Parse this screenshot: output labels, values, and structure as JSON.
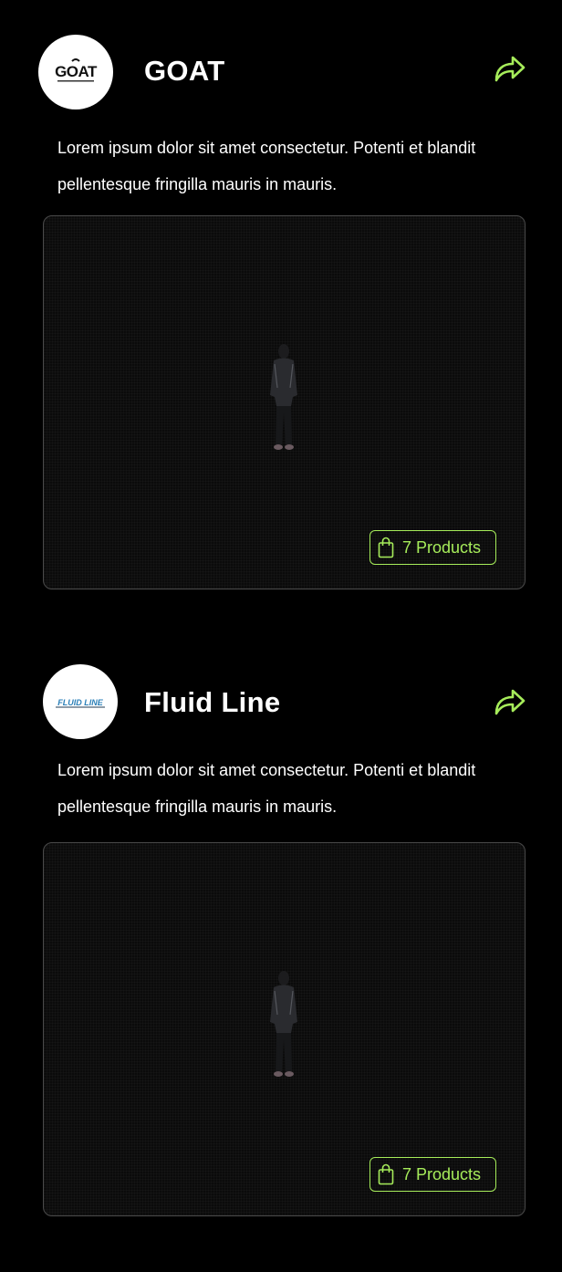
{
  "colors": {
    "background": "#000000",
    "accent": "#a6ec5a",
    "text": "#ffffff",
    "frame_border": "#4a4a4a"
  },
  "brands": [
    {
      "name": "GOAT",
      "logo_text": "GOAT",
      "description": "Lorem ipsum dolor sit amet consectetur. Potenti et blandit pellentesque fringilla mauris in mauris.",
      "products_label": "7 Products",
      "share_icon": "share-arrow-icon",
      "bag_icon": "shopping-bag-icon"
    },
    {
      "name": "Fluid Line",
      "logo_text": "FLUID LINE",
      "description": "Lorem ipsum dolor sit amet consectetur. Potenti et blandit pellentesque fringilla mauris in mauris.",
      "products_label": "7 Products",
      "share_icon": "share-arrow-icon",
      "bag_icon": "shopping-bag-icon"
    }
  ]
}
